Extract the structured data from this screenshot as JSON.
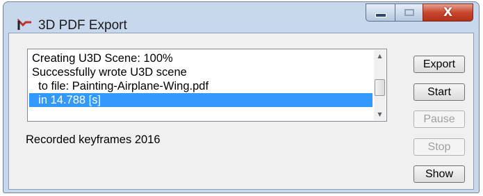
{
  "window": {
    "title": "3D PDF Export",
    "icon": "app-logo-icon",
    "controls": {
      "minimize": "minimize-icon",
      "maximize": "maximize-icon",
      "close_label": "X"
    }
  },
  "buttons": {
    "export": "Export",
    "start": "Start",
    "pause": "Pause",
    "stop": "Stop",
    "show": "Show"
  },
  "log": {
    "lines": [
      "Creating U3D Scene: 100%",
      "Successfully wrote U3D scene",
      "  to file: Painting-Airplane-Wing.pdf",
      "  in 14.788 [s]"
    ],
    "selected_index": 3
  },
  "status": {
    "text": "Recorded keyframes 2016"
  },
  "colors": {
    "selection": "#3399ff",
    "close_button": "#c7472e",
    "frame": "#c7d8ec"
  }
}
